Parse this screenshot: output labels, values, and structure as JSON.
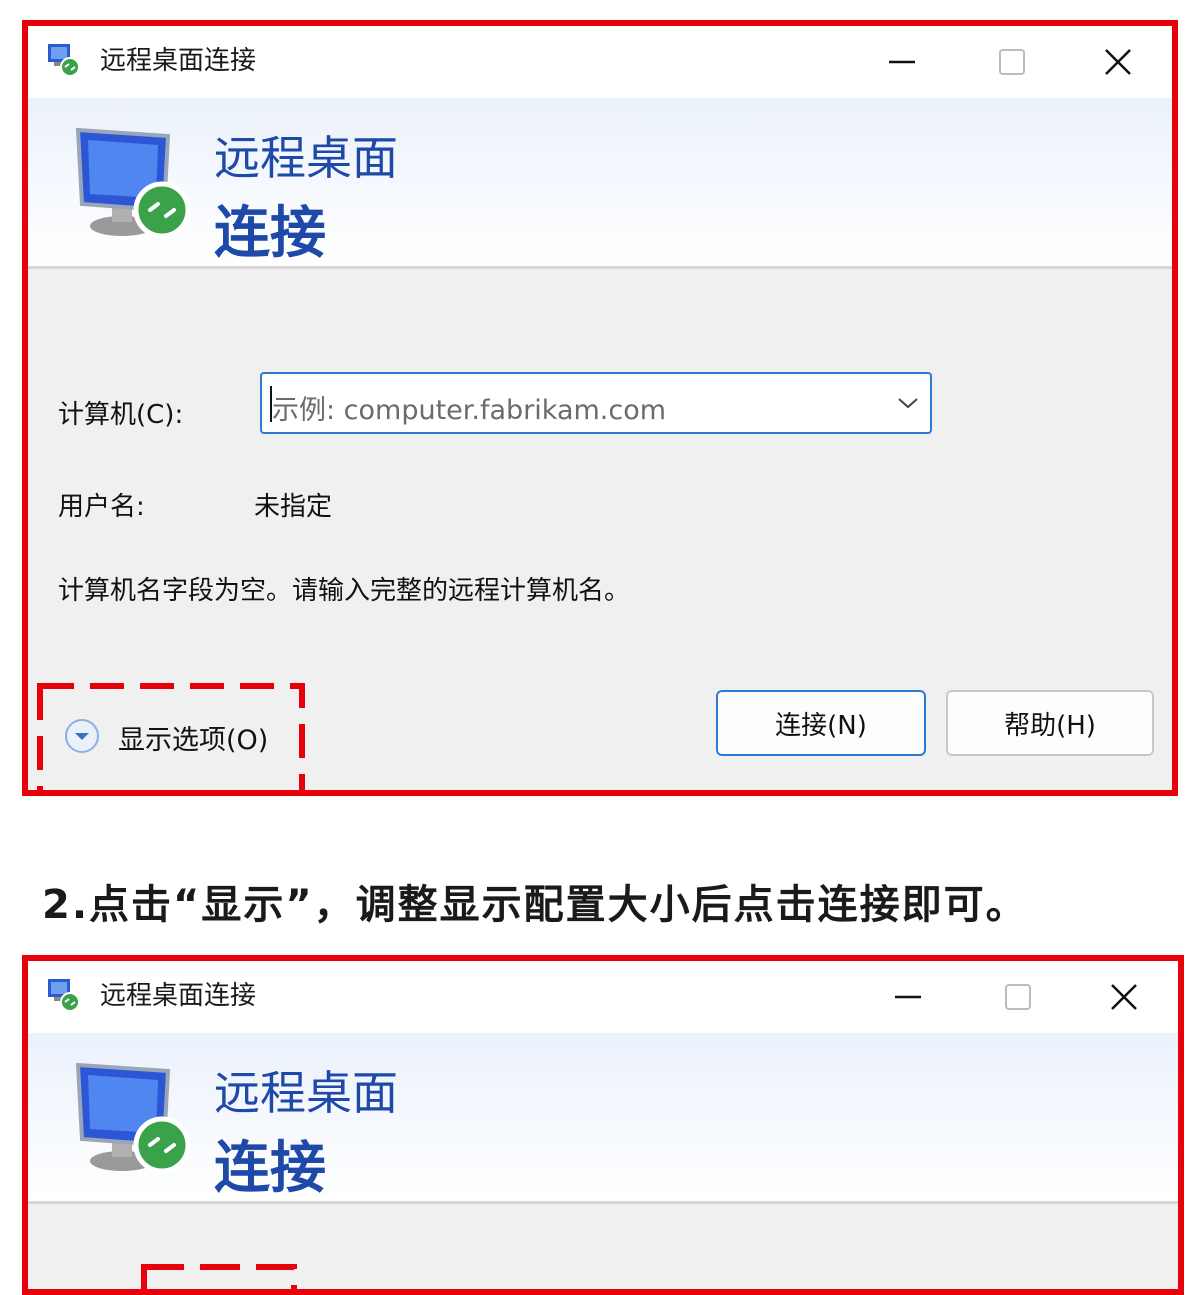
{
  "window": {
    "title": "远程桌面连接",
    "banner_line1": "远程桌面",
    "banner_line2": "连接"
  },
  "form": {
    "computer_label": "计算机(C):",
    "computer_underline_char": "C",
    "computer_placeholder": "示例: computer.fabrikam.com",
    "username_label": "用户名:",
    "username_value": "未指定",
    "message": "计算机名字段为空。请输入完整的远程计算机名。"
  },
  "actions": {
    "show_options": "显示选项(O)",
    "connect": "连接(N)",
    "help": "帮助(H)"
  },
  "caption": "2.点击“显示”，调整显示配置大小后点击连接即可。",
  "colors": {
    "highlight": "#e8000b",
    "accent": "#1e49a8",
    "focus": "#2f7ad6"
  },
  "icons": [
    "remote-desktop-icon",
    "minimize-icon",
    "maximize-icon",
    "close-icon",
    "chevron-down-icon",
    "expand-options-icon"
  ]
}
